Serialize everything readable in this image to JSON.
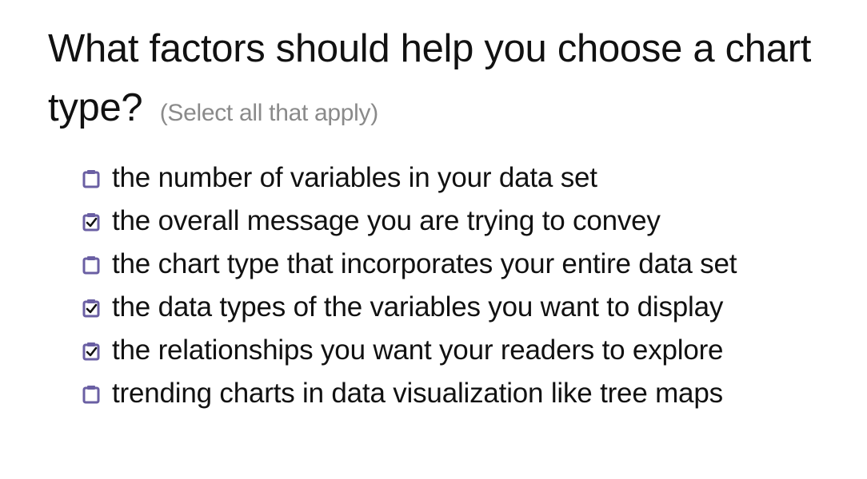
{
  "question": {
    "title": "What factors should help you choose a chart type?",
    "hint": "(Select all that apply)"
  },
  "accent_color": "#6a5fa3",
  "options": [
    {
      "label": "the number of variables in your data set",
      "checked": false
    },
    {
      "label": "the overall message you are trying to convey",
      "checked": true
    },
    {
      "label": "the chart type that incorporates your entire data set",
      "checked": false
    },
    {
      "label": "the data types of the variables you want to display",
      "checked": true
    },
    {
      "label": "the relationships you want your readers to explore",
      "checked": true
    },
    {
      "label": "trending charts in data visualization like tree maps",
      "checked": false
    }
  ]
}
